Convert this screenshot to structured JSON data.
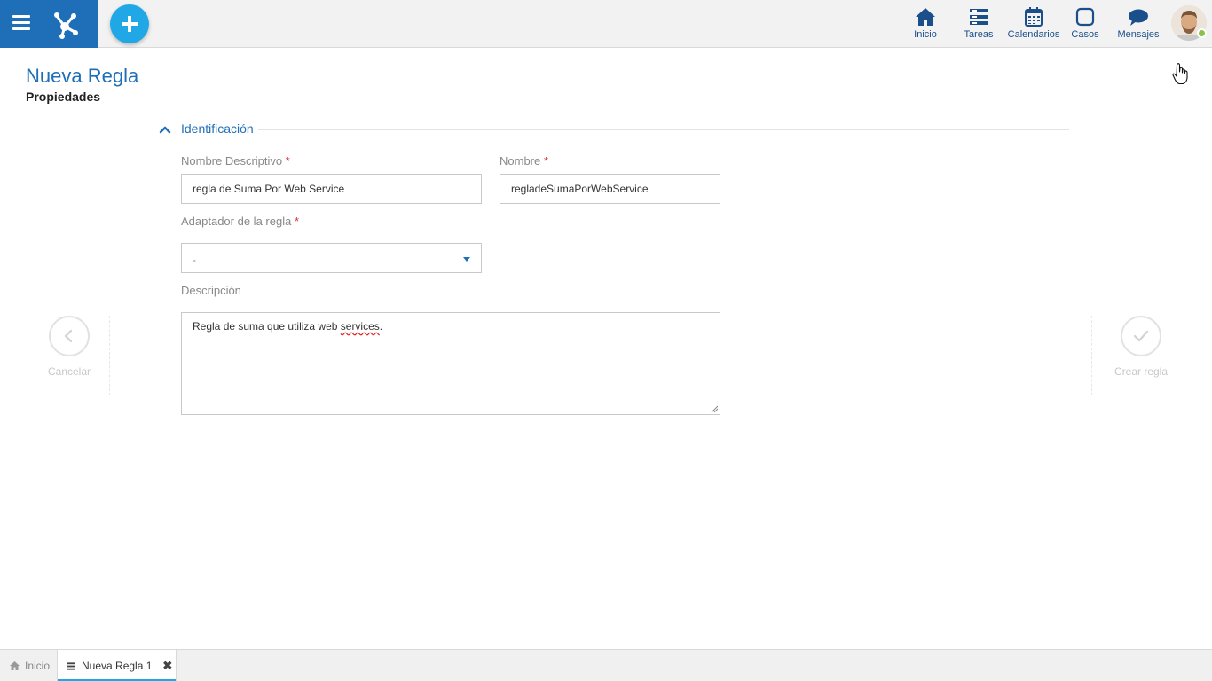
{
  "nav": {
    "items": [
      {
        "label": "Inicio",
        "icon": "home-icon"
      },
      {
        "label": "Tareas",
        "icon": "tasks-icon"
      },
      {
        "label": "Calendarios",
        "icon": "calendar-icon"
      },
      {
        "label": "Casos",
        "icon": "cases-icon"
      },
      {
        "label": "Mensajes",
        "icon": "messages-icon"
      }
    ]
  },
  "page": {
    "title": "Nueva Regla",
    "subtitle": "Propiedades"
  },
  "section": {
    "title": "Identificación",
    "expanded": true
  },
  "form": {
    "descriptive_name": {
      "label": "Nombre Descriptivo",
      "required_mark": "*",
      "value": "regla de Suma Por Web Service"
    },
    "name": {
      "label": "Nombre",
      "required_mark": "*",
      "value": "regladeSumaPorWebService"
    },
    "adapter": {
      "label": "Adaptador de la regla",
      "required_mark": "*",
      "value": "-"
    },
    "description": {
      "label": "Descripción",
      "value_prefix": "Regla de suma que utiliza web ",
      "value_misspelled": "services",
      "value_suffix": "."
    }
  },
  "actions": {
    "cancel_label": "Cancelar",
    "create_label": "Crear regla"
  },
  "tabs": {
    "home_label": "Inicio",
    "active_label": "Nueva Regla 1"
  },
  "colors": {
    "brand": "#1f6fb8",
    "accent": "#1fa7e6",
    "required": "#d9363e",
    "status_online": "#8bc34a"
  }
}
